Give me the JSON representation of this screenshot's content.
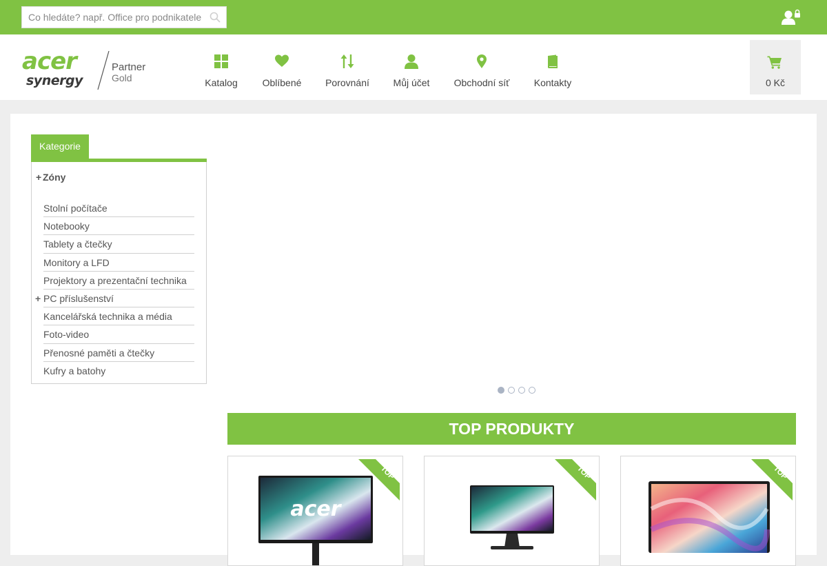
{
  "topbar": {
    "search_placeholder": "Co hledáte? např. Office pro podnikatele",
    "icons": {
      "search": "search-icon",
      "login": "user-lock-icon"
    }
  },
  "logo": {
    "brand": "acer synergy",
    "partner": "Partner",
    "level": "Gold"
  },
  "nav": [
    {
      "label": "Katalog",
      "icon": "grid-icon"
    },
    {
      "label": "Oblíbené",
      "icon": "heart-icon"
    },
    {
      "label": "Porovnání",
      "icon": "sort-arrows-icon"
    },
    {
      "label": "Můj účet",
      "icon": "user-icon"
    },
    {
      "label": "Obchodní síť",
      "icon": "map-pin-icon"
    },
    {
      "label": "Kontakty",
      "icon": "book-icon"
    }
  ],
  "cart": {
    "label": "0 Kč",
    "icon": "cart-icon"
  },
  "sidebar": {
    "tab_label": "Kategorie",
    "zones_label": "Zóny",
    "items": [
      {
        "label": "Stolní počítače",
        "expandable": false
      },
      {
        "label": "Notebooky",
        "expandable": false
      },
      {
        "label": "Tablety a čtečky",
        "expandable": false
      },
      {
        "label": "Monitory a LFD",
        "expandable": false
      },
      {
        "label": "Projektory a prezentační technika",
        "expandable": false
      },
      {
        "label": "PC příslušenství",
        "expandable": true
      },
      {
        "label": "Kancelářská technika a média",
        "expandable": false
      },
      {
        "label": "Foto-video",
        "expandable": false
      },
      {
        "label": "Přenosné paměti a čtečky",
        "expandable": false
      },
      {
        "label": "Kufry a batohy",
        "expandable": false
      }
    ]
  },
  "slider": {
    "slide_count": 4,
    "active_index": 0
  },
  "top_products": {
    "title": "TOP PRODUKTY",
    "badge": "TOP",
    "products": [
      {
        "image": "acer-monitor-logo",
        "image_brand": "acer"
      },
      {
        "image": "acer-monitor-small"
      },
      {
        "image": "laptop-colorful-wallpaper"
      }
    ]
  },
  "colors": {
    "brand_green": "#80c243",
    "background": "#eeeeee",
    "dot": "#aab4c4"
  }
}
